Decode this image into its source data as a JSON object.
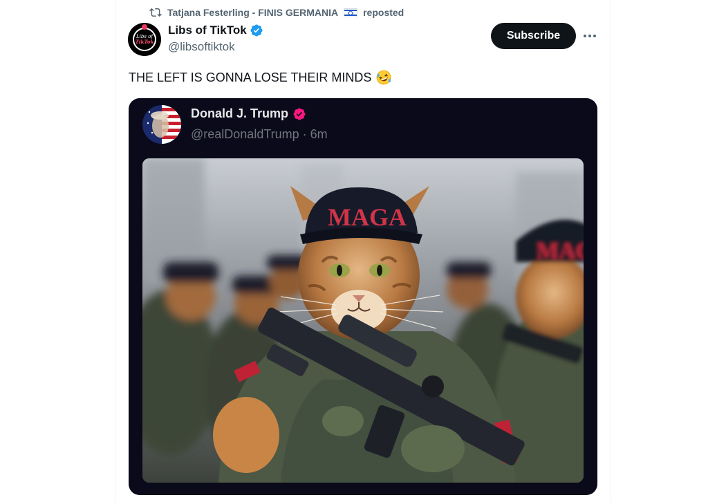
{
  "repost": {
    "reposter_name": "Tatjana Festerling - FINIS GERMANIA",
    "reposted_label": "reposted",
    "icon": "repost-icon",
    "flag_icon": "flag-icon"
  },
  "post": {
    "author_name": "Libs of TikTok",
    "author_handle": "@libsoftiktok",
    "avatar_text": [
      "Libs of",
      "TikTok"
    ],
    "subscribe_label": "Subscribe",
    "more_icon": "more-icon",
    "text": "THE LEFT IS GONNA LOSE THEIR MINDS",
    "emoji_icon": "rofl-emoji-icon"
  },
  "embedded": {
    "name": "Donald J. Trump",
    "handle_time": "@realDonaldTrump · 6m",
    "cap_text": "MAGA",
    "image_subject": "cat soldier wearing MAGA cap with rifle"
  },
  "colors": {
    "accent": "#1d9bf0",
    "text_primary": "#0f1419",
    "text_secondary": "#536471",
    "card_bg": "#0a0a1a",
    "badge_pink": "#f91880"
  }
}
